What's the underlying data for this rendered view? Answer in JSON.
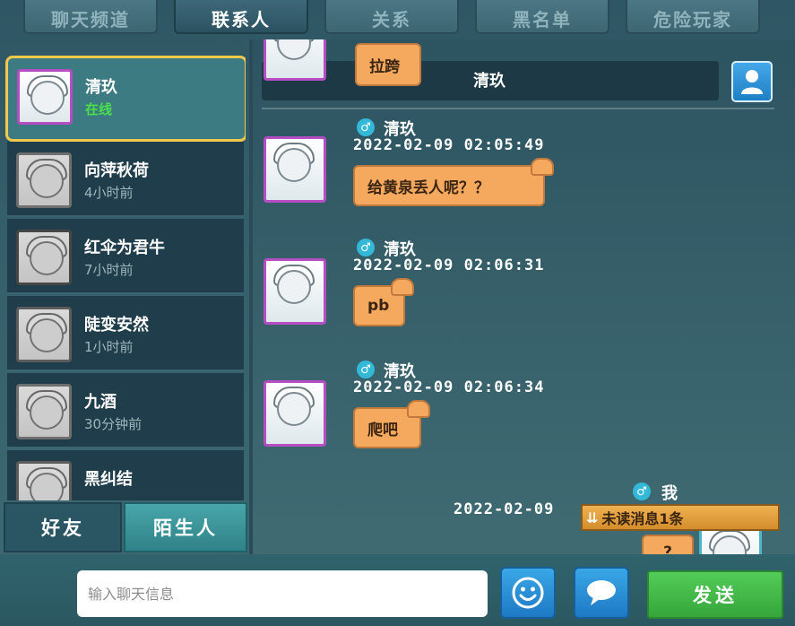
{
  "tabs": [
    {
      "label": "聊天频道",
      "active": false
    },
    {
      "label": "联系人",
      "active": true
    },
    {
      "label": "关系",
      "active": false
    },
    {
      "label": "黑名单",
      "active": false
    },
    {
      "label": "危险玩家",
      "active": false
    }
  ],
  "contacts": [
    {
      "name": "清玖",
      "status": "在线",
      "online": true,
      "selected": true
    },
    {
      "name": "向萍秋荷",
      "status": "4小时前"
    },
    {
      "name": "红伞为君牛",
      "status": "7小时前"
    },
    {
      "name": "陡变安然",
      "status": "1小时前"
    },
    {
      "name": "九酒",
      "status": "30分钟前"
    },
    {
      "name": "黑纠结",
      "status": ""
    }
  ],
  "bottom_tabs": {
    "friends": "好友",
    "stranger": "陌生人"
  },
  "chat": {
    "title_name": "清玖",
    "partial_bubble": "拉跨",
    "messages": [
      {
        "sender": "清玖",
        "gender": "♂",
        "time": "2022-02-09  02:05:49",
        "text": "给黄泉丢人呢？？"
      },
      {
        "sender": "清玖",
        "gender": "♂",
        "time": "2022-02-09  02:06:31",
        "text": "pb"
      },
      {
        "sender": "清玖",
        "gender": "♂",
        "time": "2022-02-09  02:06:34",
        "text": "爬吧"
      }
    ],
    "self_message": {
      "sender": "我",
      "gender": "♂",
      "time": "2022-02-09",
      "text": "?"
    },
    "unread_label": "未读消息1条"
  },
  "input": {
    "placeholder": "输入聊天信息",
    "value": ""
  },
  "send_label": "发送",
  "icons": {
    "emoji": "smiley-icon",
    "chat": "speech-bubble-icon",
    "profile": "user-icon"
  },
  "colors": {
    "bubble": "#f5a95f",
    "send": "#44b84a",
    "online": "#4be04b",
    "selected_border": "#f0c94c"
  }
}
